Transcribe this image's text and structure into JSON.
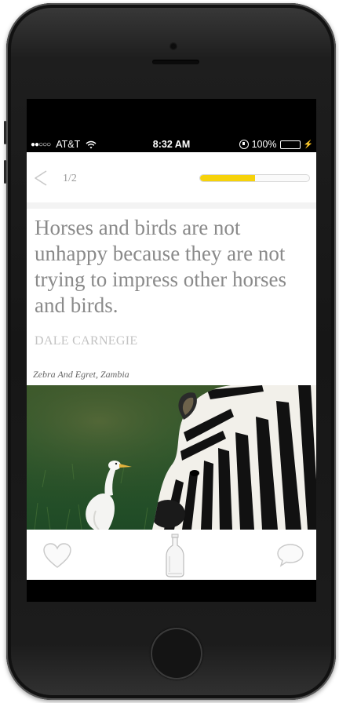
{
  "status_bar": {
    "signal": "●●○○○",
    "carrier": "AT&T",
    "wifi_icon": "wifi-icon",
    "time": "8:32 AM",
    "battery_percent": "100%",
    "battery_level": 1.0,
    "battery_color": "#4cd964"
  },
  "nav": {
    "back_icon": "back-arrow-icon",
    "page_indicator": "1/2",
    "progress": 0.5,
    "progress_color": "#f6d20a"
  },
  "quote": {
    "text": "Horses and birds are not unhappy because they are not trying to impress other horses and birds.",
    "author": "DALE CARNEGIE"
  },
  "photo": {
    "caption": "Zebra And Egret, Zambia"
  },
  "toolbar": {
    "like_icon": "heart-icon",
    "share_icon": "bottle-icon",
    "comment_icon": "comment-bubble-icon"
  }
}
